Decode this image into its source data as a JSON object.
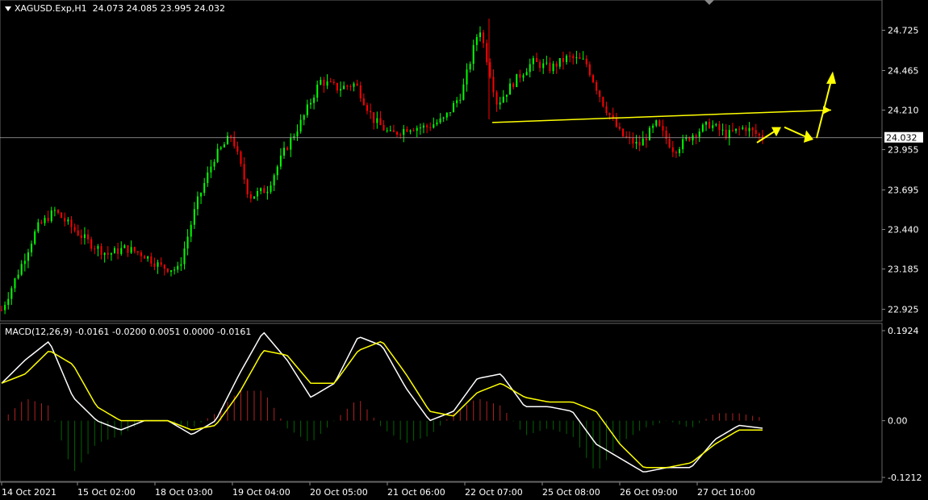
{
  "header": {
    "symbol": "XAGUSD.Exp,H1",
    "ohlc": "24.073 24.085 23.995 24.032"
  },
  "macd_header": {
    "label": "MACD(12,26,9) -0.0161 -0.0200 0.0051 0.0000 -0.0161"
  },
  "colors": {
    "background": "#000000",
    "bull_candle": "#00ff00",
    "bear_candle": "#ff0000",
    "price_line": "#ffffff",
    "trendline": "#ffff00",
    "macd_line": "#ffffff",
    "signal_line": "#ffff00",
    "hist_positive": "#b22222",
    "hist_negative": "#006400"
  },
  "chart_data": [
    {
      "type": "candlestick",
      "title": "XAGUSD.Exp,H1",
      "yticks": [
        "24.725",
        "24.465",
        "24.210",
        "23.955",
        "23.695",
        "23.440",
        "23.185",
        "22.925"
      ],
      "ylim": [
        22.85,
        24.92
      ],
      "current_price": "24.032",
      "xticks": [
        "14 Oct 2021",
        "15 Oct 02:00",
        "18 Oct 03:00",
        "19 Oct 04:00",
        "20 Oct 05:00",
        "21 Oct 06:00",
        "22 Oct 07:00",
        "25 Oct 08:00",
        "26 Oct 09:00",
        "27 Oct 10:00"
      ],
      "close_path": [
        22.92,
        23.18,
        23.45,
        23.56,
        23.45,
        23.35,
        23.28,
        23.32,
        23.28,
        23.2,
        23.18,
        23.6,
        23.9,
        24.05,
        23.65,
        23.7,
        23.95,
        24.15,
        24.4,
        24.35,
        24.38,
        24.15,
        24.05,
        24.1,
        24.1,
        24.15,
        24.32,
        24.75,
        24.25,
        24.4,
        24.52,
        24.48,
        24.55,
        24.52,
        24.25,
        24.05,
        23.98,
        24.12,
        23.95,
        24.05,
        24.12,
        24.05,
        24.1,
        24.03
      ],
      "trendline": {
        "from": 24.13,
        "to": 24.21
      },
      "arrows": [
        "up-right",
        "down-right",
        "up"
      ]
    },
    {
      "type": "line",
      "title": "MACD(12,26,9)",
      "yticks": [
        "0.1924",
        "0.00",
        "-0.1212"
      ],
      "series": [
        {
          "name": "MACD",
          "values": [
            0.08,
            0.13,
            0.17,
            0.05,
            0.0,
            -0.02,
            0.0,
            0.0,
            -0.03,
            0.0,
            0.1,
            0.19,
            0.13,
            0.05,
            0.08,
            0.18,
            0.16,
            0.07,
            0.0,
            0.02,
            0.09,
            0.1,
            0.03,
            0.03,
            0.02,
            -0.05,
            -0.08,
            -0.11,
            -0.1,
            -0.1,
            -0.04,
            -0.01,
            -0.016
          ]
        },
        {
          "name": "Signal",
          "values": [
            0.08,
            0.1,
            0.15,
            0.12,
            0.03,
            0.0,
            0.0,
            0.0,
            -0.02,
            -0.01,
            0.06,
            0.15,
            0.14,
            0.08,
            0.08,
            0.15,
            0.17,
            0.1,
            0.02,
            0.01,
            0.06,
            0.08,
            0.05,
            0.04,
            0.04,
            0.02,
            -0.05,
            -0.1,
            -0.1,
            -0.09,
            -0.05,
            -0.02,
            -0.02
          ]
        }
      ]
    }
  ]
}
